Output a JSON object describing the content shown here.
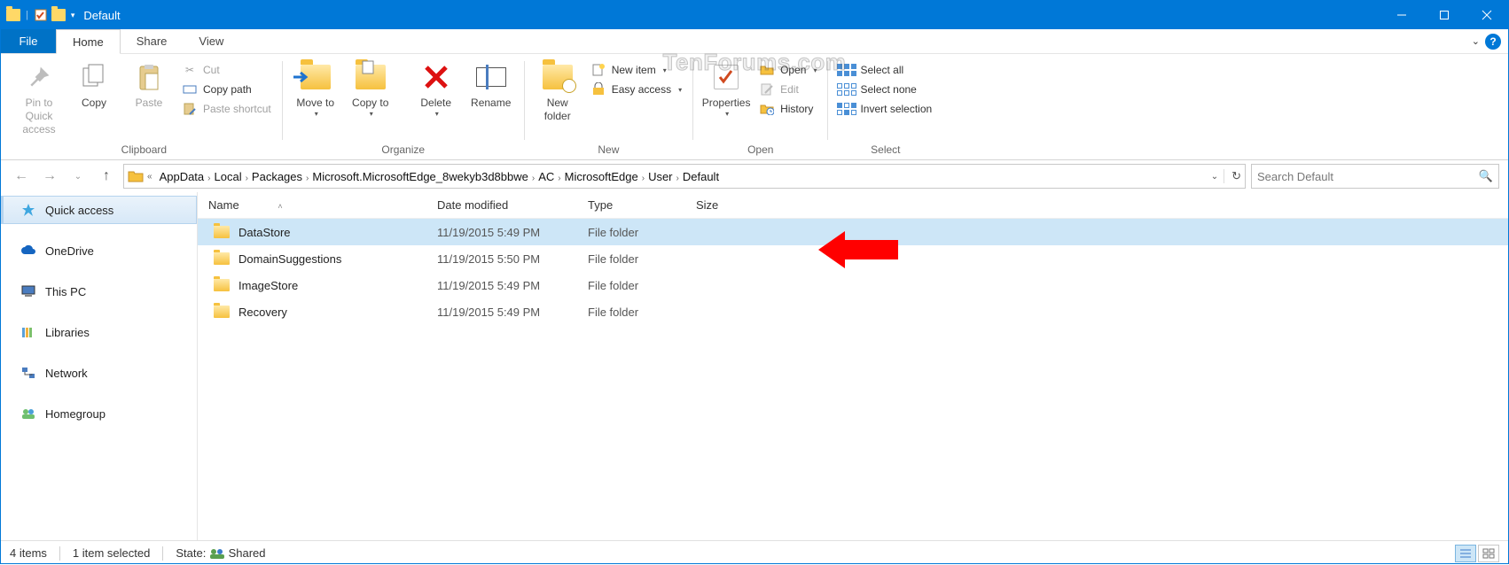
{
  "window": {
    "title": "Default"
  },
  "ribbon": {
    "file": "File",
    "tabs": [
      {
        "label": "Home",
        "active": true
      },
      {
        "label": "Share",
        "active": false
      },
      {
        "label": "View",
        "active": false
      }
    ],
    "groups": {
      "clipboard": {
        "label": "Clipboard",
        "pin": "Pin to Quick access",
        "copy": "Copy",
        "paste": "Paste",
        "cut": "Cut",
        "copy_path": "Copy path",
        "paste_shortcut": "Paste shortcut"
      },
      "organize": {
        "label": "Organize",
        "move_to": "Move to",
        "copy_to": "Copy to",
        "delete": "Delete",
        "rename": "Rename"
      },
      "new": {
        "label": "New",
        "new_folder": "New folder",
        "new_item": "New item",
        "easy_access": "Easy access"
      },
      "open": {
        "label": "Open",
        "properties": "Properties",
        "open": "Open",
        "edit": "Edit",
        "history": "History"
      },
      "select": {
        "label": "Select",
        "select_all": "Select all",
        "select_none": "Select none",
        "invert": "Invert selection"
      }
    }
  },
  "breadcrumbs": [
    "AppData",
    "Local",
    "Packages",
    "Microsoft.MicrosoftEdge_8wekyb3d8bbwe",
    "AC",
    "MicrosoftEdge",
    "User",
    "Default"
  ],
  "search": {
    "placeholder": "Search Default"
  },
  "sidebar": [
    {
      "label": "Quick access",
      "icon": "star",
      "selected": true
    },
    {
      "label": "OneDrive",
      "icon": "cloud"
    },
    {
      "label": "This PC",
      "icon": "pc"
    },
    {
      "label": "Libraries",
      "icon": "libraries"
    },
    {
      "label": "Network",
      "icon": "network"
    },
    {
      "label": "Homegroup",
      "icon": "homegroup"
    }
  ],
  "columns": {
    "name": "Name",
    "date": "Date modified",
    "type": "Type",
    "size": "Size"
  },
  "files": [
    {
      "name": "DataStore",
      "date": "11/19/2015 5:49 PM",
      "type": "File folder",
      "selected": true
    },
    {
      "name": "DomainSuggestions",
      "date": "11/19/2015 5:50 PM",
      "type": "File folder",
      "selected": false
    },
    {
      "name": "ImageStore",
      "date": "11/19/2015 5:49 PM",
      "type": "File folder",
      "selected": false
    },
    {
      "name": "Recovery",
      "date": "11/19/2015 5:49 PM",
      "type": "File folder",
      "selected": false
    }
  ],
  "status": {
    "count": "4 items",
    "selected": "1 item selected",
    "state_label": "State:",
    "state_value": "Shared"
  },
  "watermark": "TenForums.com"
}
